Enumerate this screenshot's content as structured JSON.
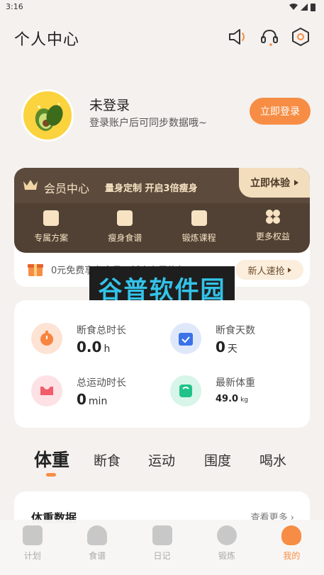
{
  "status_bar": {
    "time": "3:16"
  },
  "header": {
    "title": "个人中心",
    "icons": [
      "speaker-icon",
      "headset-icon",
      "settings-hexagon-icon"
    ]
  },
  "profile": {
    "name": "未登录",
    "subtitle": "登录账户后可同步数据哦~",
    "login_button": "立即登录",
    "avatar": "avocado-avatar"
  },
  "member": {
    "title": "会员中心",
    "slogan": "量身定制 开启3倍瘦身",
    "try_button": "立即体验",
    "benefits": [
      {
        "label": "专属方案",
        "icon": "clipboard-icon"
      },
      {
        "label": "瘦身食谱",
        "icon": "recipe-icon"
      },
      {
        "label": "锻炼课程",
        "icon": "course-icon"
      },
      {
        "label": "更多权益",
        "icon": "more-benefits-icon"
      }
    ],
    "promo_text": "0元免费享有会员，新人专属礼包",
    "promo_button": "新人速抢"
  },
  "watermark": {
    "text": "谷普软件园"
  },
  "stats": [
    {
      "label": "断食总时长",
      "value": "0.0",
      "unit": "h",
      "icon": "timer-icon",
      "color": "#f8843f"
    },
    {
      "label": "断食天数",
      "value": "0",
      "unit": "天",
      "icon": "calendar-check-icon",
      "color": "#3c72e8"
    },
    {
      "label": "总运动时长",
      "value": "0",
      "unit": "min",
      "icon": "sports-bra-icon",
      "color": "#f15d6b"
    },
    {
      "label": "最新体重",
      "value": "49.0",
      "unit": "kg",
      "icon": "scale-icon",
      "color": "#1fc38a"
    }
  ],
  "tabs": [
    "体重",
    "断食",
    "运动",
    "围度",
    "喝水"
  ],
  "weight_card": {
    "title": "体重数据",
    "more": "查看更多 ›"
  },
  "bottom_nav": [
    {
      "label": "计划",
      "icon": "plan-icon"
    },
    {
      "label": "食谱",
      "icon": "chef-hat-icon"
    },
    {
      "label": "日记",
      "icon": "diary-icon"
    },
    {
      "label": "锻炼",
      "icon": "dumbbell-icon"
    },
    {
      "label": "我的",
      "icon": "profile-icon"
    }
  ],
  "colors": {
    "accent": "#f78d44",
    "member_bg": "#504134",
    "member_text": "#f7e2c2",
    "background": "#f4f1ee"
  }
}
